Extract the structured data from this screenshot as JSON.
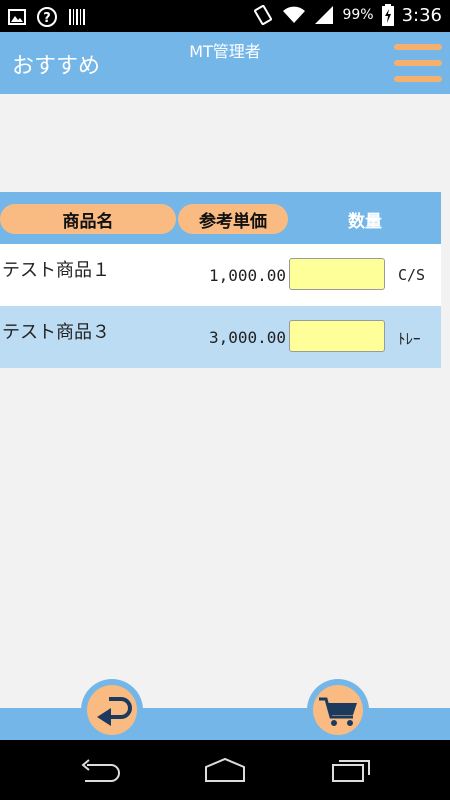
{
  "status_bar": {
    "battery": "99%",
    "time": "3:36"
  },
  "header": {
    "title": "おすすめ",
    "user": "MT管理者"
  },
  "table": {
    "columns": [
      "商品名",
      "参考単価",
      "数量"
    ],
    "rows": [
      {
        "name": "テスト商品１",
        "price": "1,000.00",
        "quantity": "",
        "unit": "C/S"
      },
      {
        "name": "テスト商品３",
        "price": "3,000.00",
        "quantity": "",
        "unit": "ﾄﾚｰ"
      }
    ]
  },
  "colors": {
    "bar_blue": "#74b6e8",
    "pill_orange": "#f9bb82",
    "row_blue": "#bcdcf4",
    "input_yellow": "#ffff99"
  },
  "icons": {
    "back": "back-arrow-icon",
    "cart": "cart-icon",
    "menu": "hamburger-menu-icon"
  }
}
